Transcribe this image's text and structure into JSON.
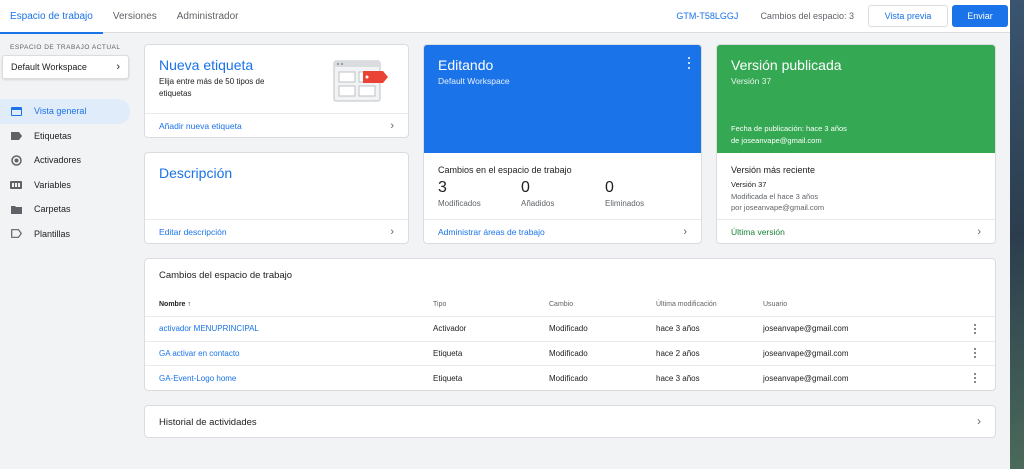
{
  "nav": {
    "tabs": [
      {
        "label": "Espacio de trabajo",
        "active": true
      },
      {
        "label": "Versiones",
        "active": false
      },
      {
        "label": "Administrador",
        "active": false
      }
    ],
    "container_id": "GTM-T58LGGJ",
    "workspace_changes": "Cambios del espacio: 3",
    "preview_label": "Vista previa",
    "submit_label": "Enviar"
  },
  "sidebar": {
    "workspace_label": "ESPACIO DE TRABAJO ACTUAL",
    "workspace_name": "Default Workspace",
    "items": [
      {
        "label": "Vista general",
        "icon": "overview-icon",
        "active": true
      },
      {
        "label": "Etiquetas",
        "icon": "tag-icon",
        "active": false
      },
      {
        "label": "Activadores",
        "icon": "trigger-icon",
        "active": false
      },
      {
        "label": "Variables",
        "icon": "variables-icon",
        "active": false
      },
      {
        "label": "Carpetas",
        "icon": "folder-icon",
        "active": false
      },
      {
        "label": "Plantillas",
        "icon": "template-icon",
        "active": false
      }
    ]
  },
  "new_tag": {
    "title": "Nueva etiqueta",
    "description": "Elija entre más de 50 tipos de etiquetas",
    "link": "Añadir nueva etiqueta"
  },
  "description_card": {
    "title": "Descripción",
    "link": "Editar descripción"
  },
  "editing": {
    "title": "Editando",
    "workspace": "Default Workspace",
    "changes_title": "Cambios en el espacio de trabajo",
    "stats": [
      {
        "value": "3",
        "label": "Modificados"
      },
      {
        "value": "0",
        "label": "Añadidos"
      },
      {
        "value": "0",
        "label": "Eliminados"
      }
    ],
    "link": "Administrar áreas de trabajo"
  },
  "published": {
    "title": "Versión publicada",
    "version": "Versión 37",
    "date_line": "Fecha de publicación: hace 3 años",
    "user_line": "de joseanvape@gmail.com",
    "recent_title": "Versión más reciente",
    "recent_version": "Versión 37",
    "recent_modified": "Modificada el hace 3 años",
    "recent_user": "por joseanvape@gmail.com",
    "link": "Última versión"
  },
  "changes_table": {
    "title": "Cambios del espacio de trabajo",
    "headers": {
      "name": "Nombre",
      "sort_arrow": "↑",
      "type": "Tipo",
      "change": "Cambio",
      "modified": "Última modificación",
      "user": "Usuario"
    },
    "rows": [
      {
        "name": "activador MENUPRINCIPAL",
        "type": "Activador",
        "change": "Modificado",
        "modified": "hace 3 años",
        "user": "joseanvape@gmail.com"
      },
      {
        "name": "GA activar en contacto",
        "type": "Etiqueta",
        "change": "Modificado",
        "modified": "hace 2 años",
        "user": "joseanvape@gmail.com"
      },
      {
        "name": "GA-Event-Logo home",
        "type": "Etiqueta",
        "change": "Modificado",
        "modified": "hace 3 años",
        "user": "joseanvape@gmail.com"
      }
    ]
  },
  "history": {
    "title": "Historial de actividades"
  },
  "colors": {
    "accent": "#1a73e8",
    "published_green": "#34a853",
    "background": "#f1f3f4"
  }
}
